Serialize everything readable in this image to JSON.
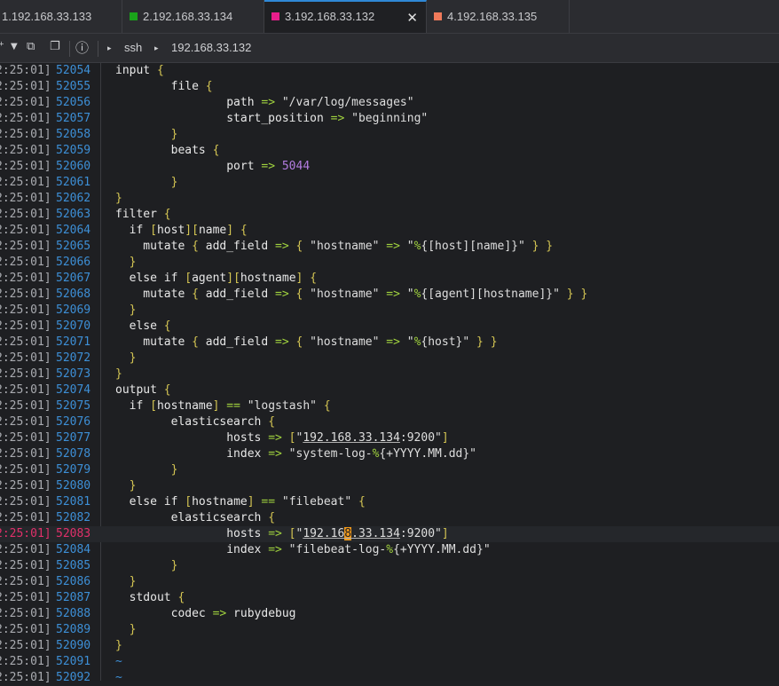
{
  "tabs": [
    {
      "label": "1.192.168.33.133",
      "color": "",
      "active": false
    },
    {
      "label": "2.192.168.33.134",
      "color": "#1aa31a",
      "active": false
    },
    {
      "label": "3.192.168.33.132",
      "color": "#e91e8c",
      "active": true
    },
    {
      "label": "4.192.168.33.135",
      "color": "#f07a5a",
      "active": false
    }
  ],
  "toolbar": {
    "protocol": "ssh",
    "host": "192.168.33.132",
    "icons": [
      "new-tab-icon",
      "dropdown-icon",
      "duplicate-icon",
      "clone-icon",
      "info-icon"
    ]
  },
  "terminal": {
    "timestamp": "2:25:01]",
    "cursor_line": "52083",
    "lines": [
      {
        "n": "52054",
        "t": "input {"
      },
      {
        "n": "52055",
        "t": "        file {"
      },
      {
        "n": "52056",
        "t": "                path => \"/var/log/messages\""
      },
      {
        "n": "52057",
        "t": "                start_position => \"beginning\""
      },
      {
        "n": "52058",
        "t": "        }"
      },
      {
        "n": "52059",
        "t": "        beats {"
      },
      {
        "n": "52060",
        "t": "                port => 5044"
      },
      {
        "n": "52061",
        "t": "        }"
      },
      {
        "n": "52062",
        "t": "}"
      },
      {
        "n": "52063",
        "t": "filter {"
      },
      {
        "n": "52064",
        "t": "  if [host][name] {"
      },
      {
        "n": "52065",
        "t": "    mutate { add_field => { \"hostname\" => \"%{[host][name]}\" } }"
      },
      {
        "n": "52066",
        "t": "  }"
      },
      {
        "n": "52067",
        "t": "  else if [agent][hostname] {"
      },
      {
        "n": "52068",
        "t": "    mutate { add_field => { \"hostname\" => \"%{[agent][hostname]}\" } }"
      },
      {
        "n": "52069",
        "t": "  }"
      },
      {
        "n": "52070",
        "t": "  else {"
      },
      {
        "n": "52071",
        "t": "    mutate { add_field => { \"hostname\" => \"%{host}\" } }"
      },
      {
        "n": "52072",
        "t": "  }"
      },
      {
        "n": "52073",
        "t": "}"
      },
      {
        "n": "52074",
        "t": "output {"
      },
      {
        "n": "52075",
        "t": "  if [hostname] == \"logstash\" {"
      },
      {
        "n": "52076",
        "t": "        elasticsearch {"
      },
      {
        "n": "52077",
        "t": "                hosts => [\"192.168.33.134:9200\"]"
      },
      {
        "n": "52078",
        "t": "                index => \"system-log-%{+YYYY.MM.dd}\""
      },
      {
        "n": "52079",
        "t": "        }"
      },
      {
        "n": "52080",
        "t": "  }"
      },
      {
        "n": "52081",
        "t": "  else if [hostname] == \"filebeat\" {"
      },
      {
        "n": "52082",
        "t": "        elasticsearch {"
      },
      {
        "n": "52083",
        "t": "                hosts => [\"192.168.33.134:9200\"]"
      },
      {
        "n": "52084",
        "t": "                index => \"filebeat-log-%{+YYYY.MM.dd}\""
      },
      {
        "n": "52085",
        "t": "        }"
      },
      {
        "n": "52086",
        "t": "  }"
      },
      {
        "n": "52087",
        "t": "  stdout {"
      },
      {
        "n": "52088",
        "t": "        codec => rubydebug"
      },
      {
        "n": "52089",
        "t": "  }"
      },
      {
        "n": "52090",
        "t": "}"
      },
      {
        "n": "52091",
        "t": "~"
      },
      {
        "n": "52092",
        "t": "~"
      }
    ]
  }
}
